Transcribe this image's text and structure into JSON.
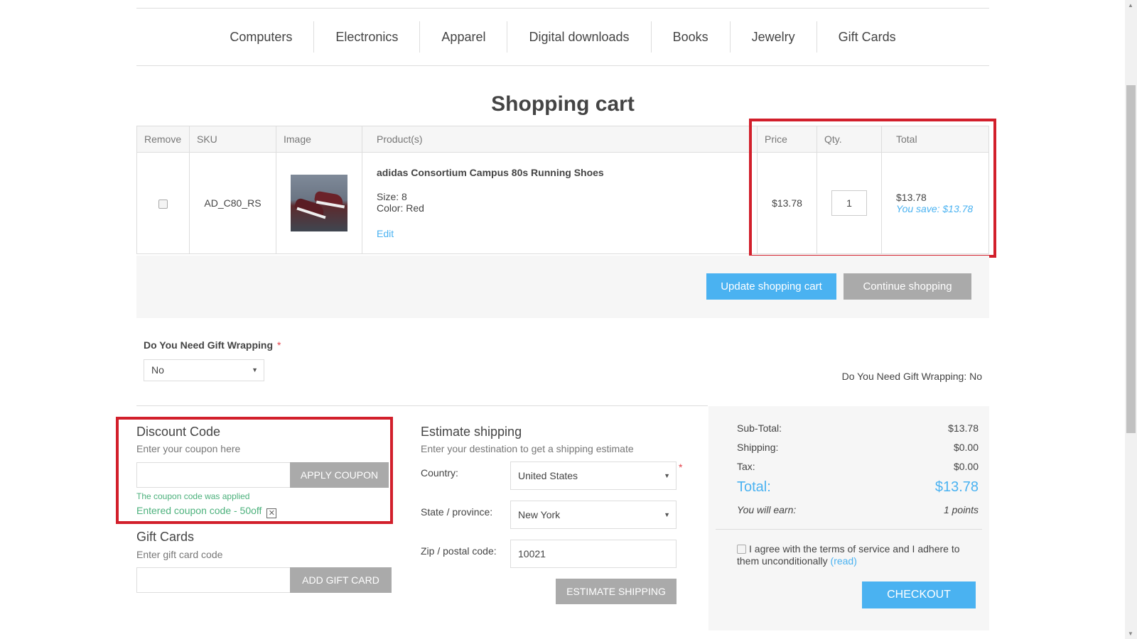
{
  "nav": {
    "items": [
      "Computers",
      "Electronics",
      "Apparel",
      "Digital downloads",
      "Books",
      "Jewelry",
      "Gift Cards"
    ]
  },
  "page": {
    "title": "Shopping cart"
  },
  "cart": {
    "headers": {
      "remove": "Remove",
      "sku": "SKU",
      "image": "Image",
      "products": "Product(s)",
      "price": "Price",
      "qty": "Qty.",
      "total": "Total"
    },
    "item": {
      "sku": "AD_C80_RS",
      "name": "adidas Consortium Campus 80s Running Shoes",
      "size": "Size: 8",
      "color": "Color: Red",
      "edit": "Edit",
      "price": "$13.78",
      "qty": "1",
      "total": "$13.78",
      "you_save": "You save: $13.78"
    },
    "update_button": "Update shopping cart",
    "continue_button": "Continue shopping"
  },
  "gift_wrapping": {
    "label": "Do You Need Gift Wrapping",
    "required": "*",
    "selected": "No",
    "summary": "Do You Need Gift Wrapping: No"
  },
  "discount": {
    "title": "Discount Code",
    "hint": "Enter your coupon here",
    "input_value": "",
    "apply_button": "APPLY COUPON",
    "applied_msg": "The coupon code was applied",
    "entered_code": "Entered coupon code - 50off"
  },
  "gift_cards": {
    "title": "Gift Cards",
    "hint": "Enter gift card code",
    "input_value": "",
    "add_button": "ADD GIFT CARD"
  },
  "shipping": {
    "title": "Estimate shipping",
    "hint": "Enter your destination to get a shipping estimate",
    "country_label": "Country:",
    "country_value": "United States",
    "required": "*",
    "state_label": "State / province:",
    "state_value": "New York",
    "zip_label": "Zip / postal code:",
    "zip_value": "10021",
    "estimate_button": "ESTIMATE SHIPPING"
  },
  "totals": {
    "subtotal_label": "Sub-Total:",
    "subtotal_value": "$13.78",
    "shipping_label": "Shipping:",
    "shipping_value": "$0.00",
    "tax_label": "Tax:",
    "tax_value": "$0.00",
    "total_label": "Total:",
    "total_value": "$13.78",
    "earn_label": "You will earn:",
    "earn_value": "1 points",
    "terms_text": "I agree with the terms of service and I adhere to them unconditionally",
    "terms_link": "(read)",
    "checkout_button": "CHECKOUT"
  },
  "colors": {
    "accent": "#4ab2f1",
    "button_gray": "#aaaaaa",
    "highlight_red": "#d21f2b",
    "success_green": "#4cb17c"
  }
}
